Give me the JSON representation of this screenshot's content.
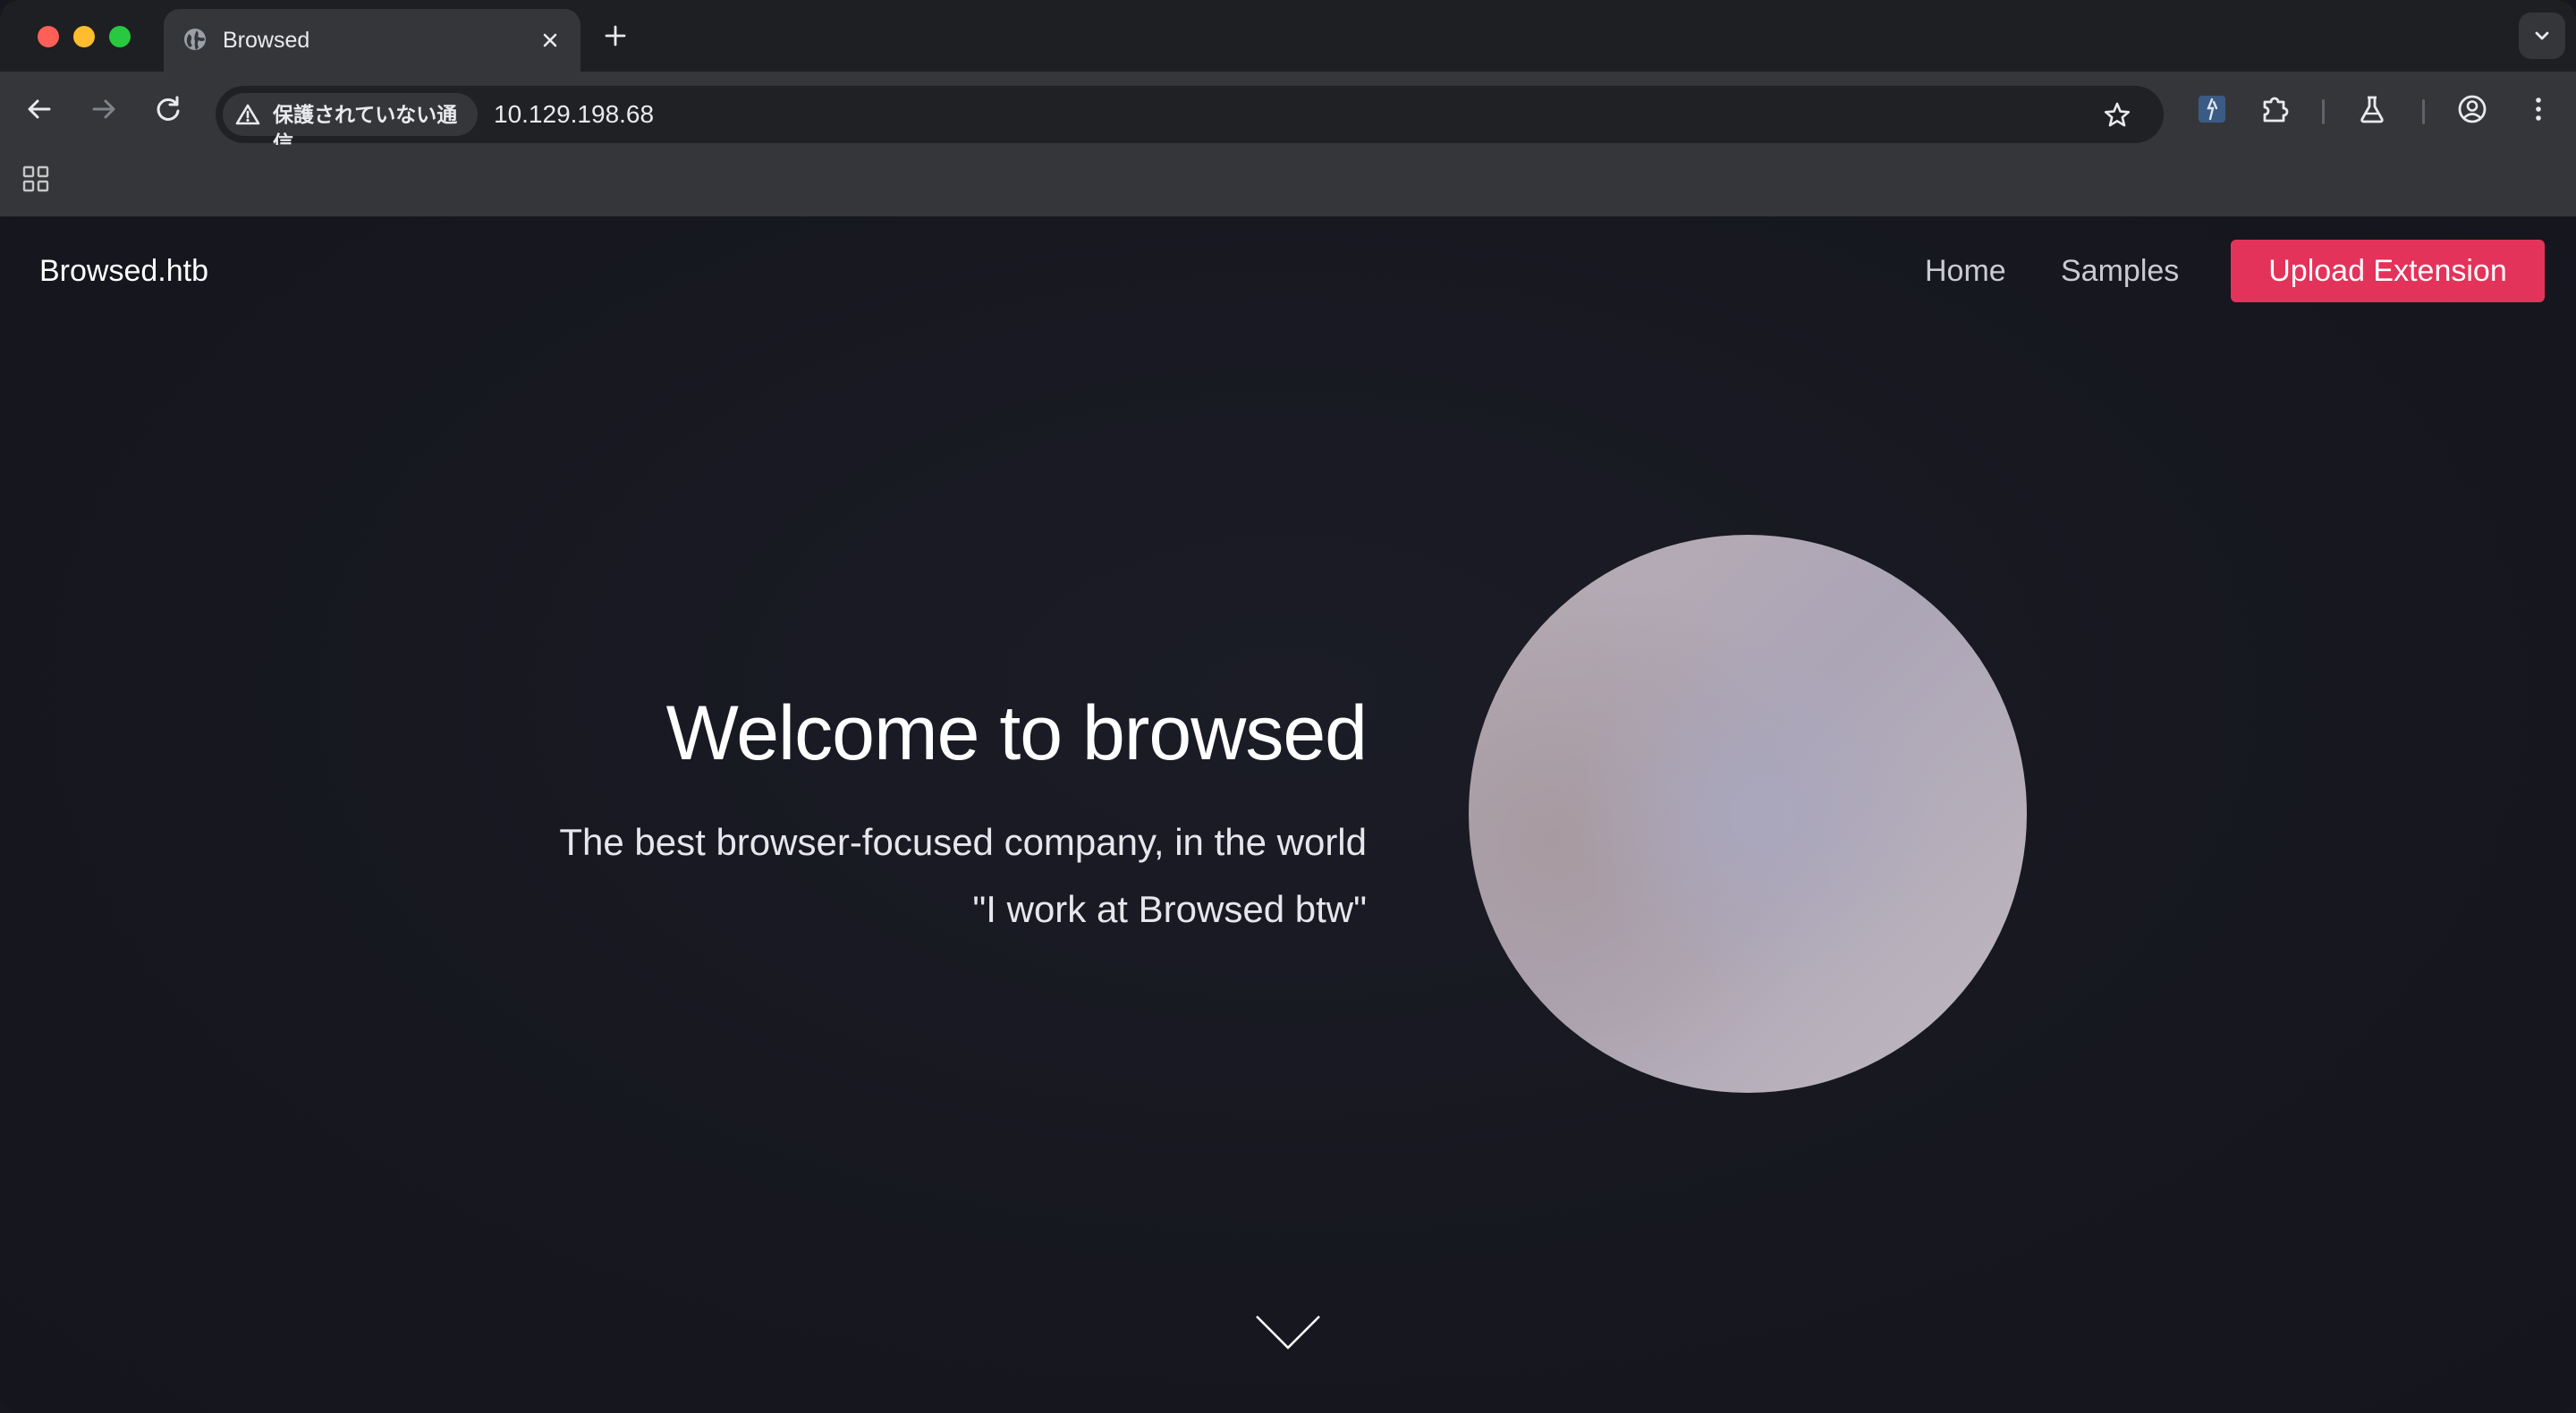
{
  "browser": {
    "tab": {
      "title": "Browsed",
      "icons": {
        "favicon": "globe-icon",
        "close": "close-icon"
      }
    },
    "new_tab_icon": "plus-icon",
    "tab_search_icon": "chevron-down-icon",
    "toolbar": {
      "icons": [
        "back-arrow-icon",
        "forward-arrow-icon",
        "reload-icon"
      ],
      "security_label": "保護されていない通信",
      "security_icon": "warning-triangle-icon",
      "url": "10.129.198.68",
      "bookmark_icon": "star-icon",
      "extensions": [
        "extension-icon",
        "puzzle-icon",
        "labs-flask-icon",
        "profile-icon",
        "kebab-menu-icon"
      ]
    },
    "bookmarks_bar": {
      "apps_icon": "apps-grid-icon"
    }
  },
  "site": {
    "brand": "Browsed.htb",
    "nav": {
      "home": "Home",
      "samples": "Samples",
      "upload": "Upload Extension"
    },
    "hero": {
      "title": "Welcome to browsed",
      "subtitle": "The best browser-focused company, in the world",
      "quote": "\"I work at Browsed btw\""
    },
    "scroll_icon": "chevron-down-icon"
  },
  "colors": {
    "accent": "#e3335a",
    "page_background": "#16171f",
    "chrome_background": "#35363a"
  }
}
